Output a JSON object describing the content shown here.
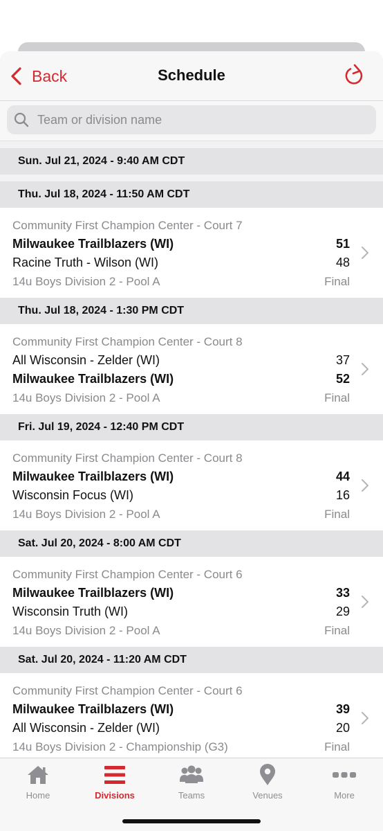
{
  "nav": {
    "back_label": "Back",
    "title": "Schedule"
  },
  "search": {
    "placeholder": "Team or division name",
    "value": ""
  },
  "top_header": "Sun. Jul 21, 2024 - 9:40 AM CDT",
  "games": [
    {
      "date_header": "Thu. Jul 18, 2024 - 11:50 AM CDT",
      "venue": "Community First Champion Center - Court 7",
      "team1": "Milwaukee Trailblazers (WI)",
      "score1": "51",
      "team1_bold": true,
      "team2": "Racine Truth - Wilson (WI)",
      "score2": "48",
      "team2_bold": false,
      "division": "14u Boys Division 2 - Pool A",
      "status": "Final"
    },
    {
      "date_header": "Thu. Jul 18, 2024 - 1:30 PM CDT",
      "venue": "Community First Champion Center - Court 8",
      "team1": "All Wisconsin - Zelder (WI)",
      "score1": "37",
      "team1_bold": false,
      "team2": "Milwaukee Trailblazers (WI)",
      "score2": "52",
      "team2_bold": true,
      "division": "14u Boys Division 2 - Pool A",
      "status": "Final"
    },
    {
      "date_header": "Fri. Jul 19, 2024 - 12:40 PM CDT",
      "venue": "Community First Champion Center - Court 8",
      "team1": "Milwaukee Trailblazers (WI)",
      "score1": "44",
      "team1_bold": true,
      "team2": "Wisconsin Focus (WI)",
      "score2": "16",
      "team2_bold": false,
      "division": "14u Boys Division 2 - Pool A",
      "status": "Final"
    },
    {
      "date_header": "Sat. Jul 20, 2024 - 8:00 AM CDT",
      "venue": "Community First Champion Center - Court 6",
      "team1": "Milwaukee Trailblazers (WI)",
      "score1": "33",
      "team1_bold": true,
      "team2": "Wisconsin Truth (WI)",
      "score2": "29",
      "team2_bold": false,
      "division": "14u Boys Division 2 - Pool A",
      "status": "Final"
    },
    {
      "date_header": "Sat. Jul 20, 2024 - 11:20 AM CDT",
      "venue": "Community First Champion Center - Court 6",
      "team1": "Milwaukee Trailblazers (WI)",
      "score1": "39",
      "team1_bold": true,
      "team2": "All Wisconsin - Zelder (WI)",
      "score2": "20",
      "team2_bold": false,
      "division": "14u Boys Division 2 - Championship (G3)",
      "status": "Final"
    }
  ],
  "tabs": [
    {
      "label": "Home",
      "icon": "home-icon",
      "active": false
    },
    {
      "label": "Divisions",
      "icon": "divisions-icon",
      "active": true
    },
    {
      "label": "Teams",
      "icon": "teams-icon",
      "active": false
    },
    {
      "label": "Venues",
      "icon": "venues-icon",
      "active": false
    },
    {
      "label": "More",
      "icon": "more-icon",
      "active": false
    }
  ],
  "colors": {
    "accent": "#d42a2f",
    "inactive": "#8e8e93",
    "header_bg": "#e3e3e6"
  }
}
